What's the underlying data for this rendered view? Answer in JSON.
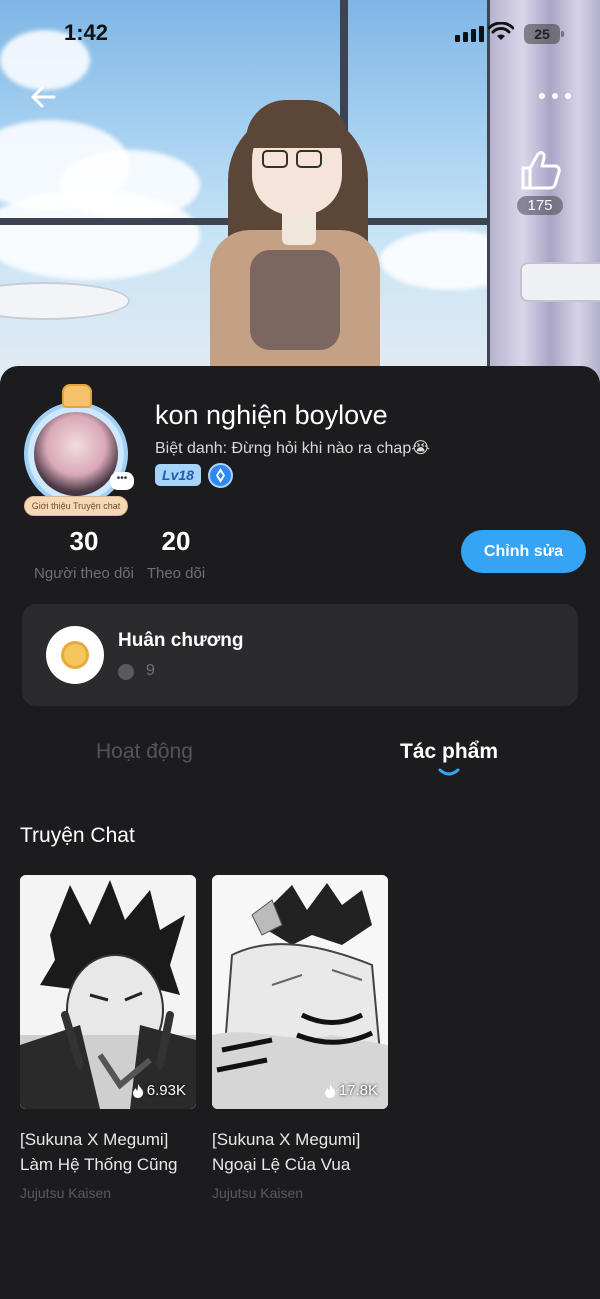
{
  "status_bar": {
    "time": "1:42",
    "battery": "25"
  },
  "hero": {
    "like_count": "175"
  },
  "profile": {
    "username": "kon nghiện boylove",
    "nickname": "Biệt danh: Đừng hỏi khi nào ra chap😭",
    "level": "Lv18",
    "avatar_tag": "Giới thiệu Truyện chat",
    "avatar_chat": "•••"
  },
  "stats": {
    "followers_count": "30",
    "followers_label": "Người theo dõi",
    "following_count": "20",
    "following_label": "Theo dõi"
  },
  "actions": {
    "edit_label": "Chỉnh sửa"
  },
  "medal": {
    "title": "Huân chương",
    "count": "9"
  },
  "tabs": [
    {
      "label": "Hoạt động",
      "active": false
    },
    {
      "label": "Tác phẩm",
      "active": true
    }
  ],
  "section": {
    "title": "Truyện Chat"
  },
  "works": [
    {
      "views": "6.93K",
      "title": "[Sukuna X Megumi] Làm Hệ Thống Cũng",
      "fandom": "Jujutsu Kaisen"
    },
    {
      "views": "17.8K",
      "title": "[Sukuna X Megumi] Ngoại Lệ Của Vua",
      "fandom": "Jujutsu Kaisen"
    }
  ],
  "colors": {
    "background": "#1c1c1e",
    "card": "#2b2b2e",
    "accent": "#35a4f4",
    "muted_text": "#6f6f74"
  },
  "icons": [
    "back-arrow-icon",
    "more-dots-icon",
    "thumbs-up-icon",
    "verified-icon",
    "medal-icon",
    "star-icon",
    "fire-icon"
  ]
}
